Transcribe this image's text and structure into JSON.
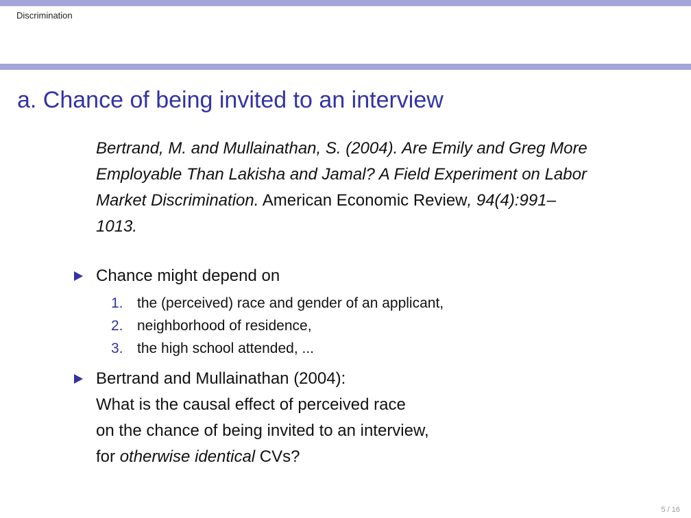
{
  "header": {
    "section": "Discrimination"
  },
  "slide": {
    "title": "a. Chance of being invited to an interview",
    "citation": {
      "part1_italic": "Bertrand, M. and Mullainathan, S. (2004). Are Emily and Greg More Employable Than Lakisha and Jamal? A Field Experiment on Labor Market Discrimination.",
      "part2_roman": " American Economic Review",
      "part3_italic": ", 94(4):991–1013."
    },
    "bullets": [
      {
        "text": "Chance might depend on",
        "items": [
          {
            "num": "1.",
            "text": "the (perceived) race and gender of an applicant,"
          },
          {
            "num": "2.",
            "text": "neighborhood of residence,"
          },
          {
            "num": "3.",
            "text": "the high school attended, ..."
          }
        ]
      },
      {
        "lines": [
          "Bertrand and Mullainathan (2004):",
          "What is the causal effect of perceived race",
          "on the chance of being invited to an interview,"
        ],
        "last_prefix": "for ",
        "last_italic": "otherwise identical",
        "last_suffix": " CVs?"
      }
    ]
  },
  "footer": {
    "page": "5 / 16"
  },
  "colors": {
    "bar": "#a3a6d9",
    "title": "#3333a6",
    "bullet": "#3333a6"
  }
}
